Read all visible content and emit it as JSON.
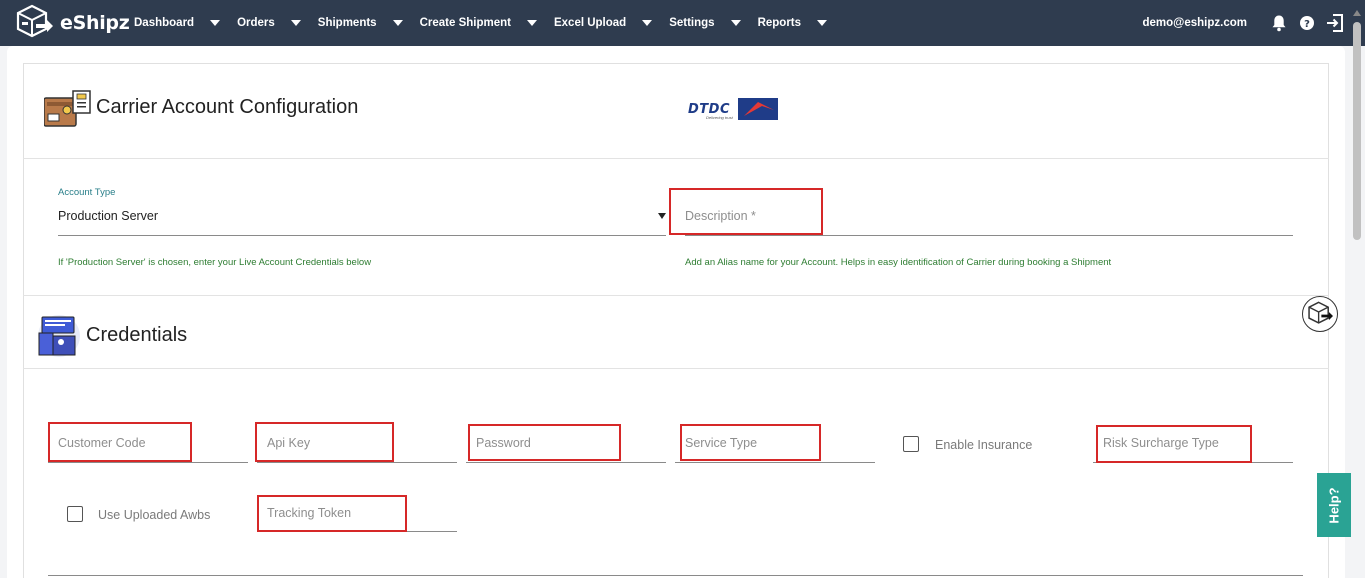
{
  "app": {
    "brand": "eShipz"
  },
  "nav": {
    "items": [
      {
        "label": "Dashboard"
      },
      {
        "label": "Orders"
      },
      {
        "label": "Shipments"
      },
      {
        "label": "Create Shipment"
      },
      {
        "label": "Excel Upload"
      },
      {
        "label": "Settings"
      },
      {
        "label": "Reports"
      }
    ],
    "user_email": "demo@eshipz.com"
  },
  "config": {
    "title": "Carrier Account Configuration",
    "carrier_logo_text": "DTDC",
    "carrier_logo_tagline": "Delivering trust",
    "account_type": {
      "label": "Account Type",
      "value": "Production Server",
      "hint": "If 'Production Server' is chosen, enter your Live Account Credentials below"
    },
    "description": {
      "placeholder": "Description *",
      "hint": "Add an Alias name for your Account. Helps in easy identification of Carrier during booking a Shipment"
    }
  },
  "credentials": {
    "title": "Credentials",
    "fields": {
      "customer_code": "Customer Code",
      "api_key": "Api Key",
      "password": "Password",
      "service_type": "Service Type",
      "enable_insurance": "Enable Insurance",
      "risk_surcharge_type": "Risk Surcharge Type",
      "use_uploaded_awbs": "Use Uploaded Awbs",
      "tracking_token": "Tracking Token"
    }
  },
  "help": {
    "label": "Help?"
  },
  "colors": {
    "navbar": "#2f3c4f",
    "highlight": "#d62828",
    "hint": "#2e7d32",
    "help": "#2aa394"
  }
}
